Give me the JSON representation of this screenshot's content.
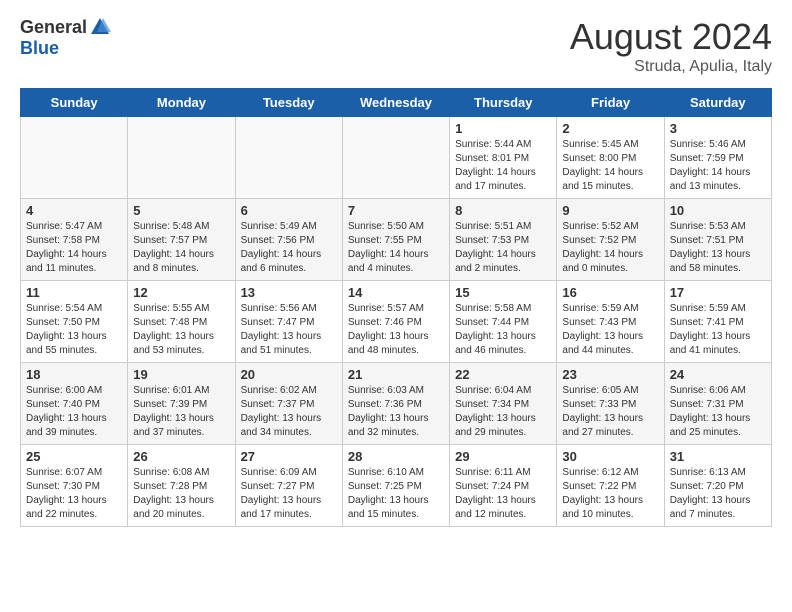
{
  "header": {
    "logo": {
      "general": "General",
      "blue": "Blue",
      "tagline": ""
    },
    "title": "August 2024",
    "subtitle": "Struda, Apulia, Italy"
  },
  "weekdays": [
    "Sunday",
    "Monday",
    "Tuesday",
    "Wednesday",
    "Thursday",
    "Friday",
    "Saturday"
  ],
  "weeks": [
    [
      {
        "day": "",
        "empty": true
      },
      {
        "day": "",
        "empty": true
      },
      {
        "day": "",
        "empty": true
      },
      {
        "day": "",
        "empty": true
      },
      {
        "day": "1",
        "sunrise": "Sunrise: 5:44 AM",
        "sunset": "Sunset: 8:01 PM",
        "daylight": "Daylight: 14 hours and 17 minutes."
      },
      {
        "day": "2",
        "sunrise": "Sunrise: 5:45 AM",
        "sunset": "Sunset: 8:00 PM",
        "daylight": "Daylight: 14 hours and 15 minutes."
      },
      {
        "day": "3",
        "sunrise": "Sunrise: 5:46 AM",
        "sunset": "Sunset: 7:59 PM",
        "daylight": "Daylight: 14 hours and 13 minutes."
      }
    ],
    [
      {
        "day": "4",
        "sunrise": "Sunrise: 5:47 AM",
        "sunset": "Sunset: 7:58 PM",
        "daylight": "Daylight: 14 hours and 11 minutes."
      },
      {
        "day": "5",
        "sunrise": "Sunrise: 5:48 AM",
        "sunset": "Sunset: 7:57 PM",
        "daylight": "Daylight: 14 hours and 8 minutes."
      },
      {
        "day": "6",
        "sunrise": "Sunrise: 5:49 AM",
        "sunset": "Sunset: 7:56 PM",
        "daylight": "Daylight: 14 hours and 6 minutes."
      },
      {
        "day": "7",
        "sunrise": "Sunrise: 5:50 AM",
        "sunset": "Sunset: 7:55 PM",
        "daylight": "Daylight: 14 hours and 4 minutes."
      },
      {
        "day": "8",
        "sunrise": "Sunrise: 5:51 AM",
        "sunset": "Sunset: 7:53 PM",
        "daylight": "Daylight: 14 hours and 2 minutes."
      },
      {
        "day": "9",
        "sunrise": "Sunrise: 5:52 AM",
        "sunset": "Sunset: 7:52 PM",
        "daylight": "Daylight: 14 hours and 0 minutes."
      },
      {
        "day": "10",
        "sunrise": "Sunrise: 5:53 AM",
        "sunset": "Sunset: 7:51 PM",
        "daylight": "Daylight: 13 hours and 58 minutes."
      }
    ],
    [
      {
        "day": "11",
        "sunrise": "Sunrise: 5:54 AM",
        "sunset": "Sunset: 7:50 PM",
        "daylight": "Daylight: 13 hours and 55 minutes."
      },
      {
        "day": "12",
        "sunrise": "Sunrise: 5:55 AM",
        "sunset": "Sunset: 7:48 PM",
        "daylight": "Daylight: 13 hours and 53 minutes."
      },
      {
        "day": "13",
        "sunrise": "Sunrise: 5:56 AM",
        "sunset": "Sunset: 7:47 PM",
        "daylight": "Daylight: 13 hours and 51 minutes."
      },
      {
        "day": "14",
        "sunrise": "Sunrise: 5:57 AM",
        "sunset": "Sunset: 7:46 PM",
        "daylight": "Daylight: 13 hours and 48 minutes."
      },
      {
        "day": "15",
        "sunrise": "Sunrise: 5:58 AM",
        "sunset": "Sunset: 7:44 PM",
        "daylight": "Daylight: 13 hours and 46 minutes."
      },
      {
        "day": "16",
        "sunrise": "Sunrise: 5:59 AM",
        "sunset": "Sunset: 7:43 PM",
        "daylight": "Daylight: 13 hours and 44 minutes."
      },
      {
        "day": "17",
        "sunrise": "Sunrise: 5:59 AM",
        "sunset": "Sunset: 7:41 PM",
        "daylight": "Daylight: 13 hours and 41 minutes."
      }
    ],
    [
      {
        "day": "18",
        "sunrise": "Sunrise: 6:00 AM",
        "sunset": "Sunset: 7:40 PM",
        "daylight": "Daylight: 13 hours and 39 minutes."
      },
      {
        "day": "19",
        "sunrise": "Sunrise: 6:01 AM",
        "sunset": "Sunset: 7:39 PM",
        "daylight": "Daylight: 13 hours and 37 minutes."
      },
      {
        "day": "20",
        "sunrise": "Sunrise: 6:02 AM",
        "sunset": "Sunset: 7:37 PM",
        "daylight": "Daylight: 13 hours and 34 minutes."
      },
      {
        "day": "21",
        "sunrise": "Sunrise: 6:03 AM",
        "sunset": "Sunset: 7:36 PM",
        "daylight": "Daylight: 13 hours and 32 minutes."
      },
      {
        "day": "22",
        "sunrise": "Sunrise: 6:04 AM",
        "sunset": "Sunset: 7:34 PM",
        "daylight": "Daylight: 13 hours and 29 minutes."
      },
      {
        "day": "23",
        "sunrise": "Sunrise: 6:05 AM",
        "sunset": "Sunset: 7:33 PM",
        "daylight": "Daylight: 13 hours and 27 minutes."
      },
      {
        "day": "24",
        "sunrise": "Sunrise: 6:06 AM",
        "sunset": "Sunset: 7:31 PM",
        "daylight": "Daylight: 13 hours and 25 minutes."
      }
    ],
    [
      {
        "day": "25",
        "sunrise": "Sunrise: 6:07 AM",
        "sunset": "Sunset: 7:30 PM",
        "daylight": "Daylight: 13 hours and 22 minutes."
      },
      {
        "day": "26",
        "sunrise": "Sunrise: 6:08 AM",
        "sunset": "Sunset: 7:28 PM",
        "daylight": "Daylight: 13 hours and 20 minutes."
      },
      {
        "day": "27",
        "sunrise": "Sunrise: 6:09 AM",
        "sunset": "Sunset: 7:27 PM",
        "daylight": "Daylight: 13 hours and 17 minutes."
      },
      {
        "day": "28",
        "sunrise": "Sunrise: 6:10 AM",
        "sunset": "Sunset: 7:25 PM",
        "daylight": "Daylight: 13 hours and 15 minutes."
      },
      {
        "day": "29",
        "sunrise": "Sunrise: 6:11 AM",
        "sunset": "Sunset: 7:24 PM",
        "daylight": "Daylight: 13 hours and 12 minutes."
      },
      {
        "day": "30",
        "sunrise": "Sunrise: 6:12 AM",
        "sunset": "Sunset: 7:22 PM",
        "daylight": "Daylight: 13 hours and 10 minutes."
      },
      {
        "day": "31",
        "sunrise": "Sunrise: 6:13 AM",
        "sunset": "Sunset: 7:20 PM",
        "daylight": "Daylight: 13 hours and 7 minutes."
      }
    ]
  ]
}
